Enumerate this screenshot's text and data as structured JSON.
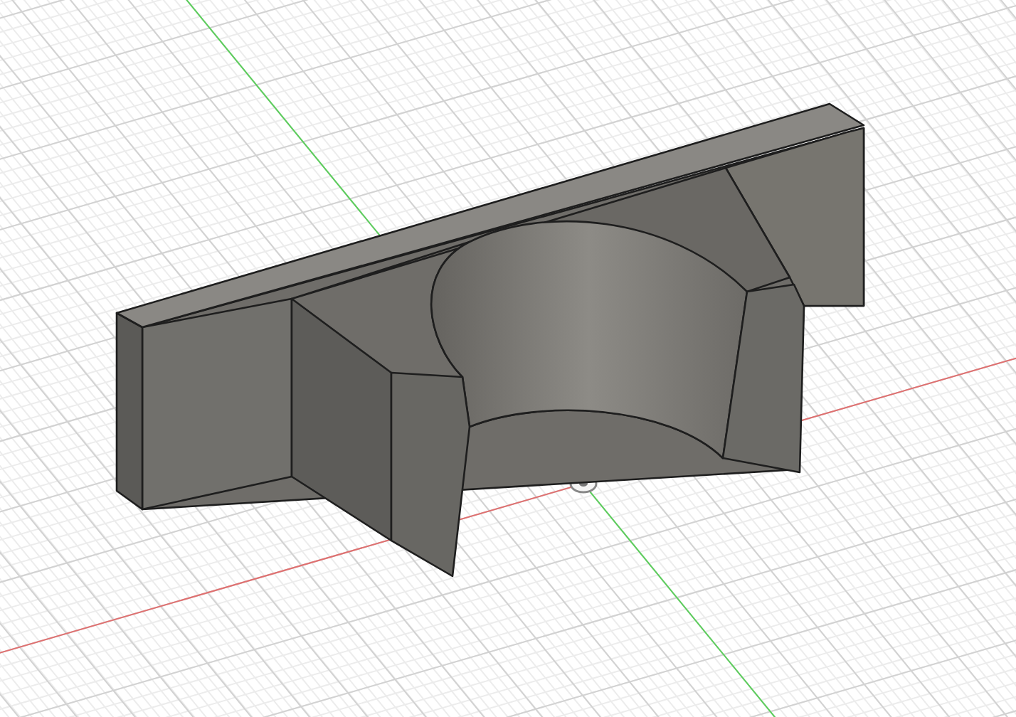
{
  "viewport": {
    "axes": [
      {
        "kind": "x",
        "color": "#e07070"
      },
      {
        "kind": "y",
        "color": "#5ccf5c"
      }
    ]
  }
}
